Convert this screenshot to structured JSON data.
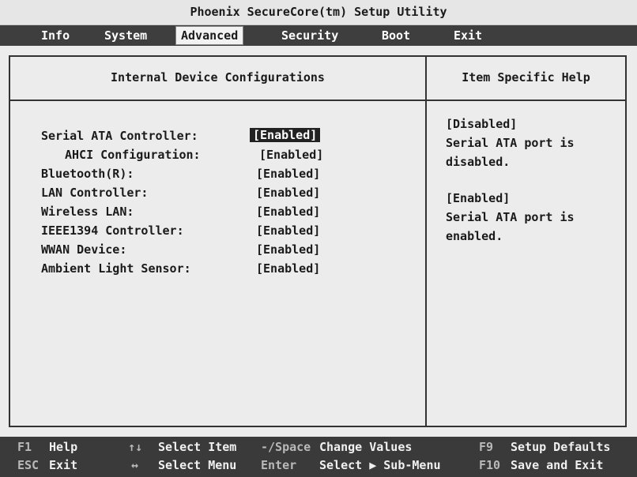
{
  "title": "Phoenix SecureCore(tm) Setup Utility",
  "menu": {
    "info": "Info",
    "system": "System",
    "advanced": "Advanced",
    "security": "Security",
    "boot": "Boot",
    "exit": "Exit"
  },
  "active_menu": "Advanced",
  "left_header": "Internal Device Configurations",
  "right_header": "Item Specific Help",
  "items": [
    {
      "label": "Serial ATA Controller:",
      "value": "[Enabled]",
      "selected": true
    },
    {
      "label": "AHCI Configuration:",
      "value": "[Enabled]",
      "indent": true
    },
    {
      "label": "Bluetooth(R):",
      "value": "[Enabled]"
    },
    {
      "label": "LAN Controller:",
      "value": "[Enabled]"
    },
    {
      "label": "Wireless LAN:",
      "value": "[Enabled]"
    },
    {
      "label": "IEEE1394 Controller:",
      "value": "[Enabled]"
    },
    {
      "label": "WWAN Device:",
      "value": "[Enabled]"
    },
    {
      "label": "Ambient Light Sensor:",
      "value": "[Enabled]"
    }
  ],
  "help": [
    "[Disabled]",
    "Serial ATA port is",
    "disabled.",
    "[Enabled]",
    "Serial ATA port is",
    "enabled."
  ],
  "footer": {
    "f1_key": "F1",
    "f1_desc": "Help",
    "updown_key": "↑↓",
    "updown_desc": "Select Item",
    "minus_key": "-/Space",
    "minus_desc": "Change Values",
    "f9_key": "F9",
    "f9_desc": "Setup Defaults",
    "esc_key": "ESC",
    "esc_desc": "Exit",
    "leftright_key": "↔",
    "leftright_desc": "Select Menu",
    "enter_key": "Enter",
    "enter_desc": "Select ▶ Sub-Menu",
    "f10_key": "F10",
    "f10_desc": "Save and Exit"
  },
  "colors": {
    "background": "#ececec",
    "menu_bar": "#3e3e3e",
    "footer_bar": "#3a3a3a",
    "selection": "#222222"
  }
}
